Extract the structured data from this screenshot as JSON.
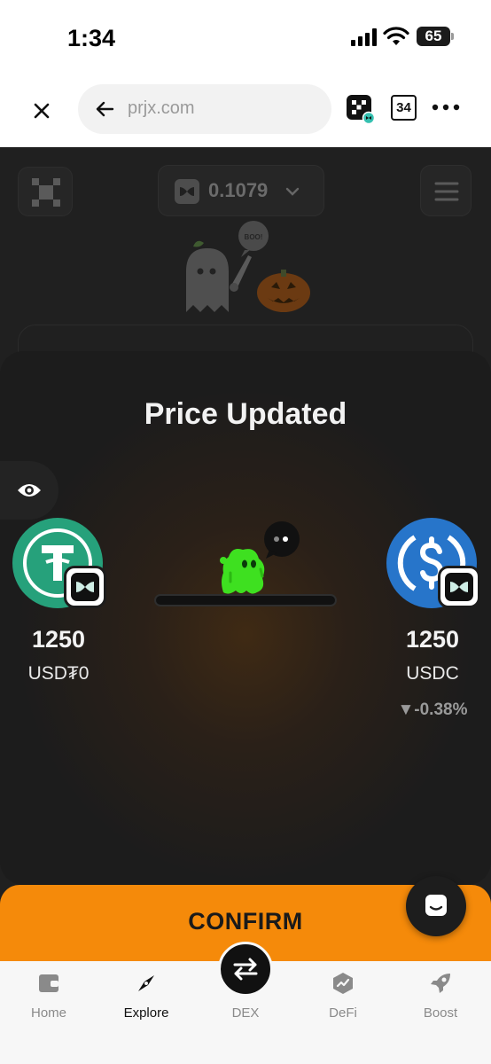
{
  "status_bar": {
    "time": "1:34",
    "battery": "65"
  },
  "browser": {
    "url": "prjx.com",
    "tab_count": "34"
  },
  "header": {
    "balance": "0.1079",
    "mascot_bubble": "BOO!"
  },
  "modal": {
    "title": "Price Updated",
    "from_token": {
      "amount": "1250",
      "symbol": "USD₮0",
      "logo_color": "#26a17b"
    },
    "to_token": {
      "amount": "1250",
      "symbol": "USDC",
      "price_change": "▼-0.38%",
      "logo_color": "#2775ca"
    }
  },
  "actions": {
    "confirm_label": "CONFIRM",
    "accent_color": "#f58a0a"
  },
  "bottom_nav": {
    "items": [
      {
        "label": "Home",
        "icon": "wallet-icon"
      },
      {
        "label": "Explore",
        "icon": "compass-icon",
        "active": true
      },
      {
        "label": "DEX",
        "icon": "swap-icon"
      },
      {
        "label": "DeFi",
        "icon": "defi-icon"
      },
      {
        "label": "Boost",
        "icon": "rocket-icon"
      }
    ]
  }
}
